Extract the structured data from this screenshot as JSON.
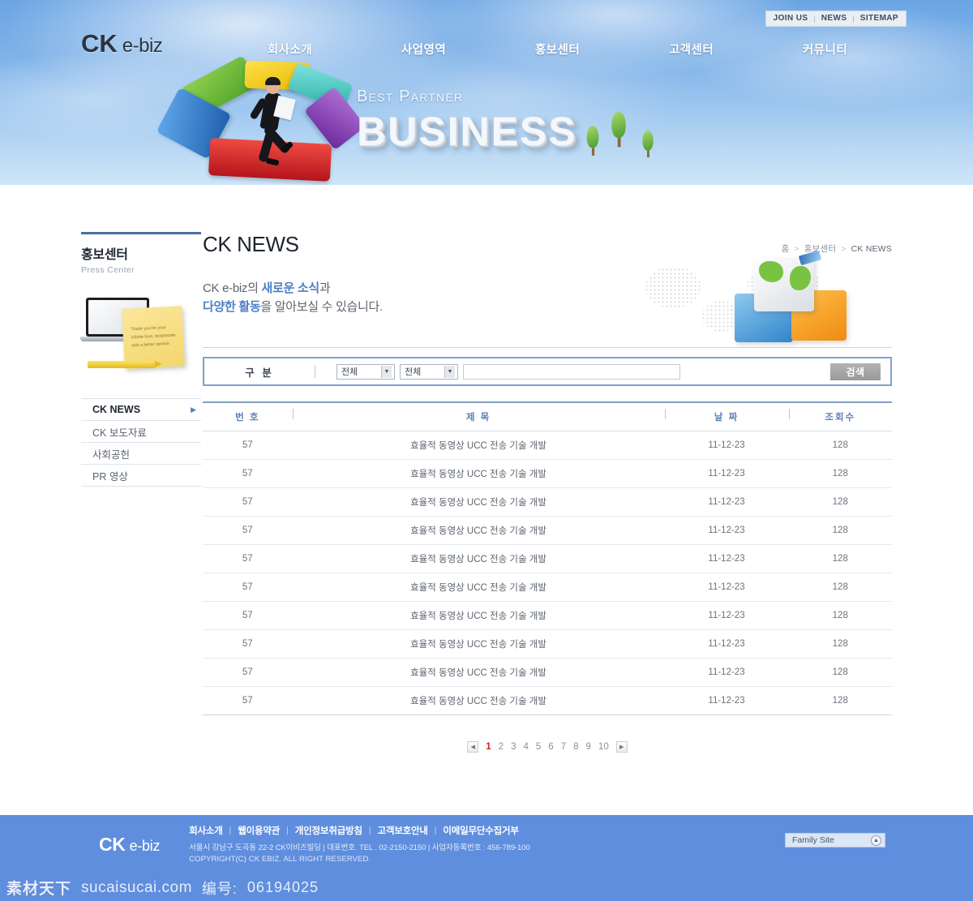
{
  "header": {
    "utility_links": [
      "JOIN US",
      "NEWS",
      "SITEMAP"
    ],
    "brand_ck": "CK",
    "brand_ebiz": "e-biz",
    "nav": [
      "회사소개",
      "사업영역",
      "홍보센터",
      "고객센터",
      "커뮤니티"
    ],
    "hero_tagline": "Best Partner",
    "hero_headline": "BUSINESS"
  },
  "sidebar": {
    "title": "홍보센터",
    "subtitle": "Press Center",
    "sticky_note": "Thank you for your infinite love, reciprocate with a better service.",
    "items": [
      {
        "label": "CK NEWS",
        "active": true
      },
      {
        "label": "CK 보도자료",
        "active": false
      },
      {
        "label": "사회공헌",
        "active": false
      },
      {
        "label": "PR 영상",
        "active": false
      }
    ]
  },
  "main": {
    "page_title": "CK NEWS",
    "breadcrumb": [
      "홈",
      "홍보센터",
      "CK NEWS"
    ],
    "intro_line1_a": "CK e-biz의 ",
    "intro_line1_b": "새로운 소식",
    "intro_line1_c": "과",
    "intro_line2_a": "다양한 활동",
    "intro_line2_b": "을 알아보실 수 있습니다."
  },
  "search": {
    "label": "구 분",
    "select1_value": "전체",
    "select2_value": "전체",
    "input_value": "",
    "input_placeholder": "",
    "button_label": "검색"
  },
  "table": {
    "columns": [
      "번 호",
      "제 목",
      "날 짜",
      "조회수"
    ],
    "rows": [
      {
        "no": "57",
        "title": "효율적 동영상 UCC 전송 기술 개발",
        "date": "11-12-23",
        "hits": "128"
      },
      {
        "no": "57",
        "title": "효율적 동영상 UCC 전송 기술 개발",
        "date": "11-12-23",
        "hits": "128"
      },
      {
        "no": "57",
        "title": "효율적 동영상 UCC 전송 기술 개발",
        "date": "11-12-23",
        "hits": "128"
      },
      {
        "no": "57",
        "title": "효율적 동영상 UCC 전송 기술 개발",
        "date": "11-12-23",
        "hits": "128"
      },
      {
        "no": "57",
        "title": "효율적 동영상 UCC 전송 기술 개발",
        "date": "11-12-23",
        "hits": "128"
      },
      {
        "no": "57",
        "title": "효율적 동영상 UCC 전송 기술 개발",
        "date": "11-12-23",
        "hits": "128"
      },
      {
        "no": "57",
        "title": "효율적 동영상 UCC 전송 기술 개발",
        "date": "11-12-23",
        "hits": "128"
      },
      {
        "no": "57",
        "title": "효율적 동영상 UCC 전송 기술 개발",
        "date": "11-12-23",
        "hits": "128"
      },
      {
        "no": "57",
        "title": "효율적 동영상 UCC 전송 기술 개발",
        "date": "11-12-23",
        "hits": "128"
      },
      {
        "no": "57",
        "title": "효율적 동영상 UCC 전송 기술 개발",
        "date": "11-12-23",
        "hits": "128"
      }
    ]
  },
  "pagination": {
    "prev": "◀",
    "next": "▶",
    "pages": [
      "1",
      "2",
      "3",
      "4",
      "5",
      "6",
      "7",
      "8",
      "9",
      "10"
    ],
    "current": "1"
  },
  "footer": {
    "brand_ck": "CK",
    "brand_ebiz": "e-biz",
    "links": [
      "회사소개",
      "웹이용약관",
      "개인정보취급방침",
      "고객보호안내",
      "이메일무단수집거부"
    ],
    "address": "서울시 강남구 도곡동 22-2 CK이비즈빌딩  | 대표번호. TEL . 02-2150-2150 |  사업자등록번호 : 456-789-100",
    "copyright": "COPYRIGHT(C) CK EBIZ. ALL RIGHT RESERVED.",
    "family_site_label": "Family Site"
  },
  "watermark": {
    "site_cn": "素材天下",
    "site_en": "sucaisucai.com",
    "id_label": "编号:",
    "id_value": "06194025"
  },
  "colors": {
    "sky_blue": "#6aa4e4",
    "footer_blue": "#5f8ede",
    "accent_blue": "#4f7fc4",
    "rule_blue": "#4a6fa5",
    "active_red": "#cc2222"
  }
}
